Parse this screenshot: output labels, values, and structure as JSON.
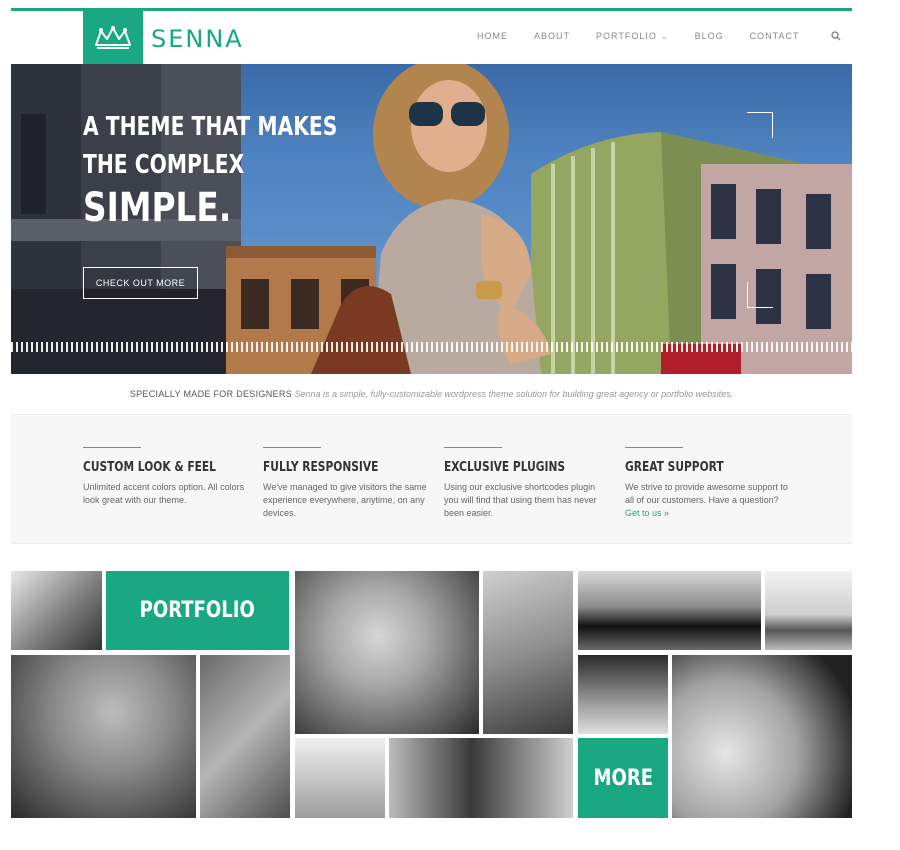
{
  "brand": {
    "name": "SENNA",
    "logo_icon": "crown-icon"
  },
  "nav": {
    "items": [
      {
        "label": "HOME"
      },
      {
        "label": "ABOUT"
      },
      {
        "label": "PORTFOLIO",
        "has_dropdown": true
      },
      {
        "label": "BLOG"
      },
      {
        "label": "CONTACT"
      }
    ],
    "search_icon": "search-icon"
  },
  "hero": {
    "line1": "A THEME THAT MAKES",
    "line2": "THE COMPLEX",
    "line3": "SIMPLE.",
    "button": "CHECK OUT MORE"
  },
  "tagline": {
    "lead": "SPECIALLY MADE FOR DESIGNERS",
    "rest": "Senna is a simple, fully-customizable wordpress theme solution for building great agency or portfolio websites."
  },
  "features": [
    {
      "title": "CUSTOM LOOK & FEEL",
      "text": "Unlimited accent colors option. All colors look great with our theme."
    },
    {
      "title": "FULLY RESPONSIVE",
      "text": "We've managed to give visitors the same experience everywhere, anytime, on any devices."
    },
    {
      "title": "EXCLUSIVE PLUGINS",
      "text": "Using our exclusive shortcodes plugin you will find that using them has never been easier."
    },
    {
      "title": "GREAT SUPPORT",
      "text": "We strive to provide awesome support to all of our customers. Have a question?",
      "link": "Get to us »"
    }
  ],
  "portfolio": {
    "label": "PORTFOLIO",
    "more": "MORE"
  },
  "colors": {
    "accent": "#1aa882"
  }
}
